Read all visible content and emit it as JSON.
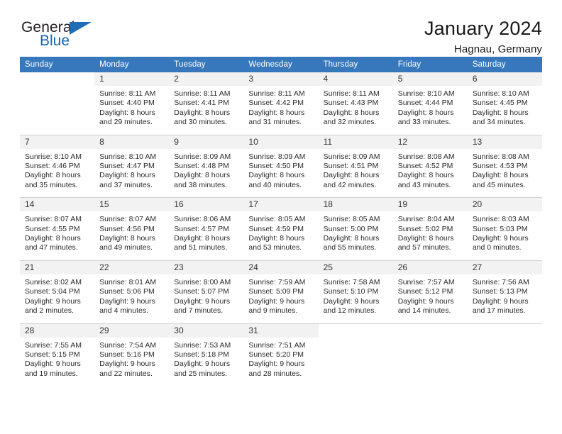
{
  "brand": {
    "name_top": "General",
    "name_bottom": "Blue",
    "accent_color": "#1f6db5",
    "text_color": "#231f20"
  },
  "header": {
    "title": "January 2024",
    "subtitle": "Hagnau, Germany",
    "header_bg": "#3778bc",
    "header_text_color": "#ffffff",
    "daynum_bg": "#f2f2f2"
  },
  "weekdays": [
    "Sunday",
    "Monday",
    "Tuesday",
    "Wednesday",
    "Thursday",
    "Friday",
    "Saturday"
  ],
  "labels": {
    "sunrise_prefix": "Sunrise:",
    "sunset_prefix": "Sunset:",
    "daylight_prefix": "Daylight:"
  },
  "weeks": [
    [
      {
        "day": "",
        "sunrise": "",
        "sunset": "",
        "daylight_line1": "",
        "daylight_line2": ""
      },
      {
        "day": "1",
        "sunrise": "Sunrise: 8:11 AM",
        "sunset": "Sunset: 4:40 PM",
        "daylight_line1": "Daylight: 8 hours",
        "daylight_line2": "and 29 minutes."
      },
      {
        "day": "2",
        "sunrise": "Sunrise: 8:11 AM",
        "sunset": "Sunset: 4:41 PM",
        "daylight_line1": "Daylight: 8 hours",
        "daylight_line2": "and 30 minutes."
      },
      {
        "day": "3",
        "sunrise": "Sunrise: 8:11 AM",
        "sunset": "Sunset: 4:42 PM",
        "daylight_line1": "Daylight: 8 hours",
        "daylight_line2": "and 31 minutes."
      },
      {
        "day": "4",
        "sunrise": "Sunrise: 8:11 AM",
        "sunset": "Sunset: 4:43 PM",
        "daylight_line1": "Daylight: 8 hours",
        "daylight_line2": "and 32 minutes."
      },
      {
        "day": "5",
        "sunrise": "Sunrise: 8:10 AM",
        "sunset": "Sunset: 4:44 PM",
        "daylight_line1": "Daylight: 8 hours",
        "daylight_line2": "and 33 minutes."
      },
      {
        "day": "6",
        "sunrise": "Sunrise: 8:10 AM",
        "sunset": "Sunset: 4:45 PM",
        "daylight_line1": "Daylight: 8 hours",
        "daylight_line2": "and 34 minutes."
      }
    ],
    [
      {
        "day": "7",
        "sunrise": "Sunrise: 8:10 AM",
        "sunset": "Sunset: 4:46 PM",
        "daylight_line1": "Daylight: 8 hours",
        "daylight_line2": "and 35 minutes."
      },
      {
        "day": "8",
        "sunrise": "Sunrise: 8:10 AM",
        "sunset": "Sunset: 4:47 PM",
        "daylight_line1": "Daylight: 8 hours",
        "daylight_line2": "and 37 minutes."
      },
      {
        "day": "9",
        "sunrise": "Sunrise: 8:09 AM",
        "sunset": "Sunset: 4:48 PM",
        "daylight_line1": "Daylight: 8 hours",
        "daylight_line2": "and 38 minutes."
      },
      {
        "day": "10",
        "sunrise": "Sunrise: 8:09 AM",
        "sunset": "Sunset: 4:50 PM",
        "daylight_line1": "Daylight: 8 hours",
        "daylight_line2": "and 40 minutes."
      },
      {
        "day": "11",
        "sunrise": "Sunrise: 8:09 AM",
        "sunset": "Sunset: 4:51 PM",
        "daylight_line1": "Daylight: 8 hours",
        "daylight_line2": "and 42 minutes."
      },
      {
        "day": "12",
        "sunrise": "Sunrise: 8:08 AM",
        "sunset": "Sunset: 4:52 PM",
        "daylight_line1": "Daylight: 8 hours",
        "daylight_line2": "and 43 minutes."
      },
      {
        "day": "13",
        "sunrise": "Sunrise: 8:08 AM",
        "sunset": "Sunset: 4:53 PM",
        "daylight_line1": "Daylight: 8 hours",
        "daylight_line2": "and 45 minutes."
      }
    ],
    [
      {
        "day": "14",
        "sunrise": "Sunrise: 8:07 AM",
        "sunset": "Sunset: 4:55 PM",
        "daylight_line1": "Daylight: 8 hours",
        "daylight_line2": "and 47 minutes."
      },
      {
        "day": "15",
        "sunrise": "Sunrise: 8:07 AM",
        "sunset": "Sunset: 4:56 PM",
        "daylight_line1": "Daylight: 8 hours",
        "daylight_line2": "and 49 minutes."
      },
      {
        "day": "16",
        "sunrise": "Sunrise: 8:06 AM",
        "sunset": "Sunset: 4:57 PM",
        "daylight_line1": "Daylight: 8 hours",
        "daylight_line2": "and 51 minutes."
      },
      {
        "day": "17",
        "sunrise": "Sunrise: 8:05 AM",
        "sunset": "Sunset: 4:59 PM",
        "daylight_line1": "Daylight: 8 hours",
        "daylight_line2": "and 53 minutes."
      },
      {
        "day": "18",
        "sunrise": "Sunrise: 8:05 AM",
        "sunset": "Sunset: 5:00 PM",
        "daylight_line1": "Daylight: 8 hours",
        "daylight_line2": "and 55 minutes."
      },
      {
        "day": "19",
        "sunrise": "Sunrise: 8:04 AM",
        "sunset": "Sunset: 5:02 PM",
        "daylight_line1": "Daylight: 8 hours",
        "daylight_line2": "and 57 minutes."
      },
      {
        "day": "20",
        "sunrise": "Sunrise: 8:03 AM",
        "sunset": "Sunset: 5:03 PM",
        "daylight_line1": "Daylight: 9 hours",
        "daylight_line2": "and 0 minutes."
      }
    ],
    [
      {
        "day": "21",
        "sunrise": "Sunrise: 8:02 AM",
        "sunset": "Sunset: 5:04 PM",
        "daylight_line1": "Daylight: 9 hours",
        "daylight_line2": "and 2 minutes."
      },
      {
        "day": "22",
        "sunrise": "Sunrise: 8:01 AM",
        "sunset": "Sunset: 5:06 PM",
        "daylight_line1": "Daylight: 9 hours",
        "daylight_line2": "and 4 minutes."
      },
      {
        "day": "23",
        "sunrise": "Sunrise: 8:00 AM",
        "sunset": "Sunset: 5:07 PM",
        "daylight_line1": "Daylight: 9 hours",
        "daylight_line2": "and 7 minutes."
      },
      {
        "day": "24",
        "sunrise": "Sunrise: 7:59 AM",
        "sunset": "Sunset: 5:09 PM",
        "daylight_line1": "Daylight: 9 hours",
        "daylight_line2": "and 9 minutes."
      },
      {
        "day": "25",
        "sunrise": "Sunrise: 7:58 AM",
        "sunset": "Sunset: 5:10 PM",
        "daylight_line1": "Daylight: 9 hours",
        "daylight_line2": "and 12 minutes."
      },
      {
        "day": "26",
        "sunrise": "Sunrise: 7:57 AM",
        "sunset": "Sunset: 5:12 PM",
        "daylight_line1": "Daylight: 9 hours",
        "daylight_line2": "and 14 minutes."
      },
      {
        "day": "27",
        "sunrise": "Sunrise: 7:56 AM",
        "sunset": "Sunset: 5:13 PM",
        "daylight_line1": "Daylight: 9 hours",
        "daylight_line2": "and 17 minutes."
      }
    ],
    [
      {
        "day": "28",
        "sunrise": "Sunrise: 7:55 AM",
        "sunset": "Sunset: 5:15 PM",
        "daylight_line1": "Daylight: 9 hours",
        "daylight_line2": "and 19 minutes."
      },
      {
        "day": "29",
        "sunrise": "Sunrise: 7:54 AM",
        "sunset": "Sunset: 5:16 PM",
        "daylight_line1": "Daylight: 9 hours",
        "daylight_line2": "and 22 minutes."
      },
      {
        "day": "30",
        "sunrise": "Sunrise: 7:53 AM",
        "sunset": "Sunset: 5:18 PM",
        "daylight_line1": "Daylight: 9 hours",
        "daylight_line2": "and 25 minutes."
      },
      {
        "day": "31",
        "sunrise": "Sunrise: 7:51 AM",
        "sunset": "Sunset: 5:20 PM",
        "daylight_line1": "Daylight: 9 hours",
        "daylight_line2": "and 28 minutes."
      },
      {
        "day": "",
        "sunrise": "",
        "sunset": "",
        "daylight_line1": "",
        "daylight_line2": ""
      },
      {
        "day": "",
        "sunrise": "",
        "sunset": "",
        "daylight_line1": "",
        "daylight_line2": ""
      },
      {
        "day": "",
        "sunrise": "",
        "sunset": "",
        "daylight_line1": "",
        "daylight_line2": ""
      }
    ]
  ]
}
